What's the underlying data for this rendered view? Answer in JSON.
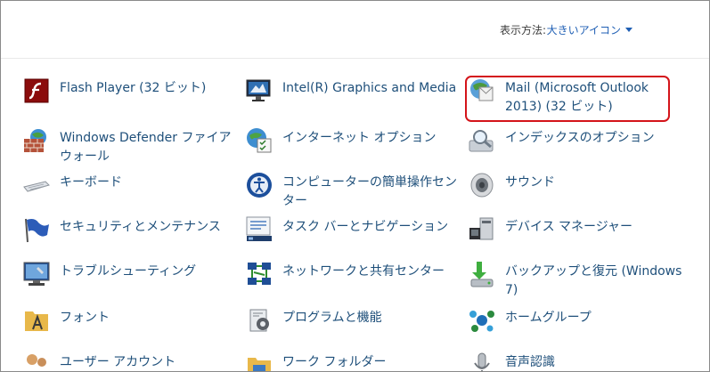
{
  "view": {
    "label": "表示方法:",
    "value": "大きいアイコン"
  },
  "items": [
    {
      "label": "Flash Player (32 ビット)",
      "icon": "flash-player-icon"
    },
    {
      "label": "Intel(R) Graphics and Media",
      "icon": "intel-graphics-icon"
    },
    {
      "label": "Mail (Microsoft Outlook 2013) (32 ビット)",
      "icon": "mail-icon"
    },
    {
      "label": "Windows Defender ファイアウォール",
      "icon": "firewall-icon"
    },
    {
      "label": "インターネット オプション",
      "icon": "internet-options-icon"
    },
    {
      "label": "インデックスのオプション",
      "icon": "indexing-options-icon"
    },
    {
      "label": "キーボード",
      "icon": "keyboard-icon"
    },
    {
      "label": "コンピューターの簡単操作センター",
      "icon": "ease-of-access-icon"
    },
    {
      "label": "サウンド",
      "icon": "sound-icon"
    },
    {
      "label": "セキュリティとメンテナンス",
      "icon": "security-flag-icon"
    },
    {
      "label": "タスク バーとナビゲーション",
      "icon": "taskbar-icon"
    },
    {
      "label": "デバイス マネージャー",
      "icon": "device-manager-icon"
    },
    {
      "label": "トラブルシューティング",
      "icon": "troubleshooting-icon"
    },
    {
      "label": "ネットワークと共有センター",
      "icon": "network-sharing-icon"
    },
    {
      "label": "バックアップと復元 (Windows 7)",
      "icon": "backup-restore-icon"
    },
    {
      "label": "フォント",
      "icon": "fonts-icon"
    },
    {
      "label": "プログラムと機能",
      "icon": "programs-features-icon"
    },
    {
      "label": "ホームグループ",
      "icon": "homegroup-icon"
    },
    {
      "label": "ユーザー アカウント",
      "icon": "user-accounts-icon"
    },
    {
      "label": "ワーク フォルダー",
      "icon": "work-folders-icon"
    },
    {
      "label": "音声認識",
      "icon": "speech-recognition-icon"
    }
  ],
  "colors": {
    "link": "#1e4f7a",
    "dropdown": "#1f5fb4",
    "highlight": "#d4141a"
  }
}
